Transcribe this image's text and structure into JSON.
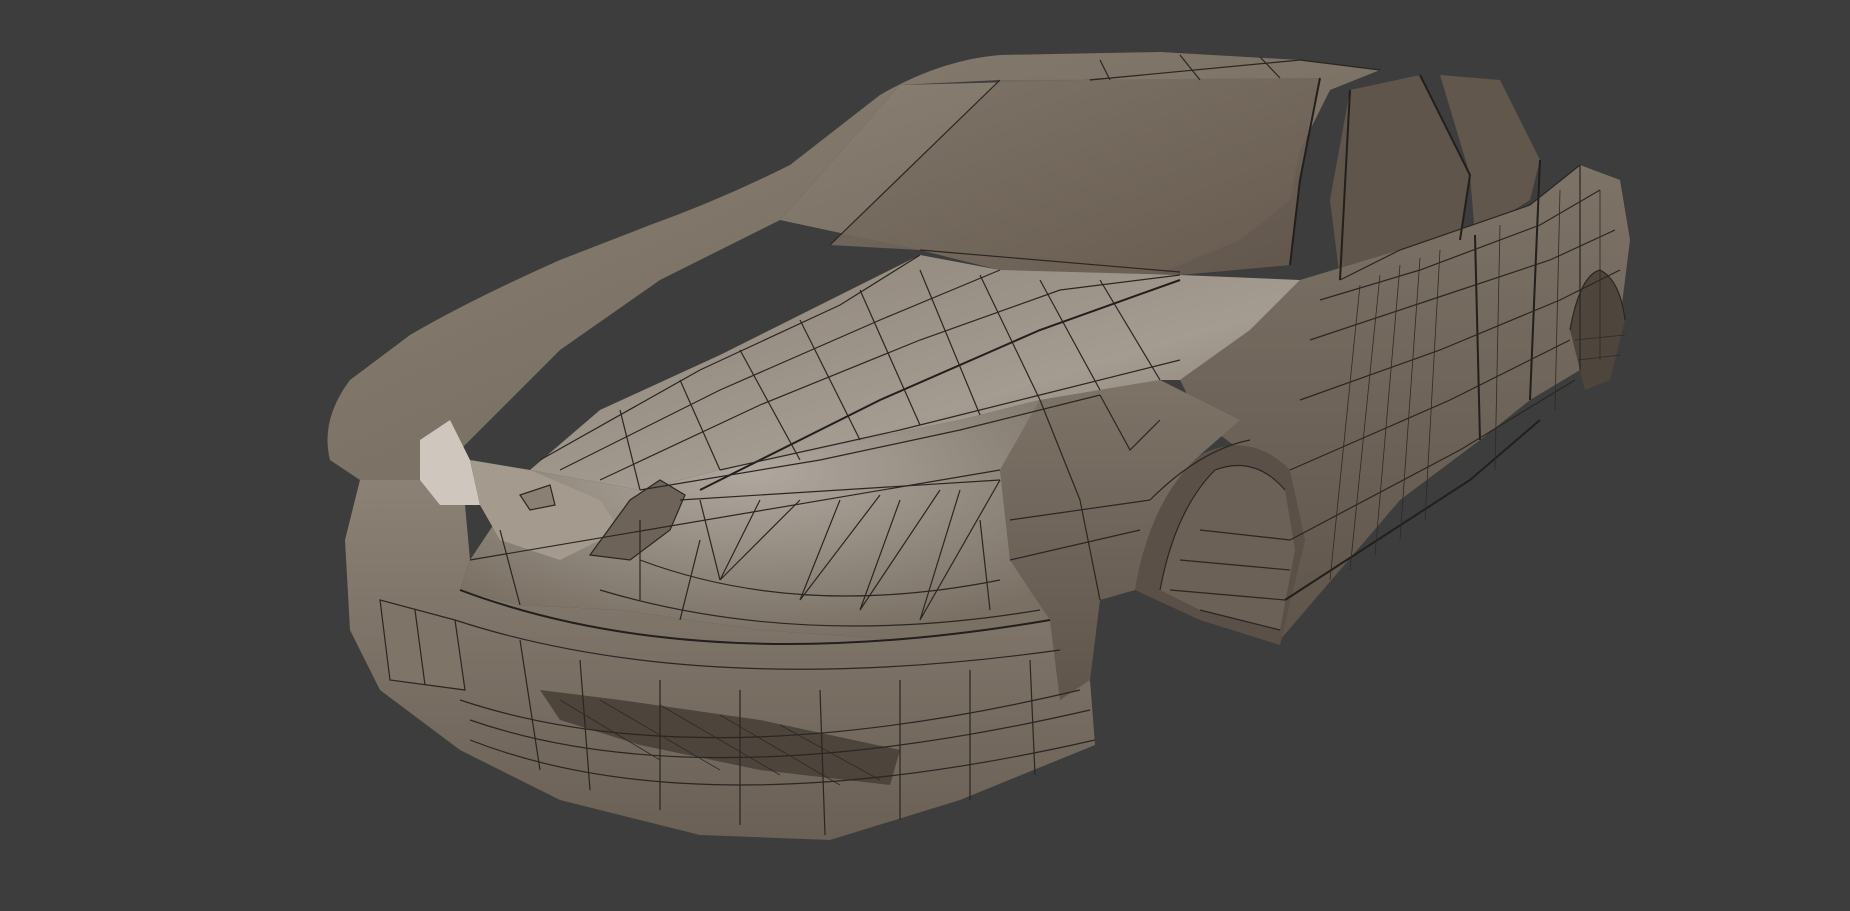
{
  "viewport": {
    "background": "#3d3d3d",
    "shading_mode": "solid",
    "wireframe_overlay": true
  },
  "model": {
    "object": "car-body-mesh",
    "surface_color": "#7b7165",
    "surface_highlight": "#aaa29a",
    "surface_shadow": "#5a5047",
    "edge_color": "#2a2622"
  }
}
